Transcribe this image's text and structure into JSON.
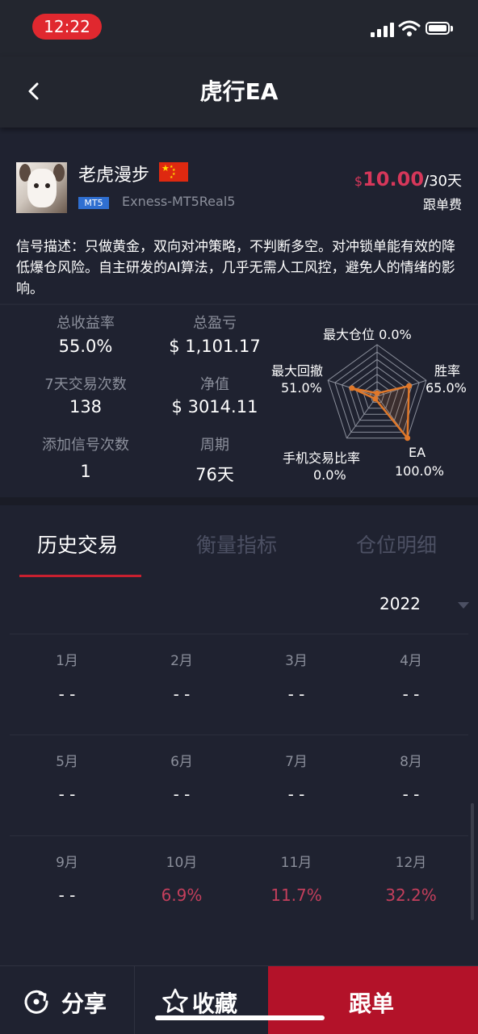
{
  "status_bar": {
    "time": "12:22"
  },
  "header": {
    "title": "虎行EA"
  },
  "profile": {
    "name": "老虎漫步",
    "platform_badge": "MT5",
    "server": "Exness-MT5Real5",
    "price_currency": "$",
    "price_amount": "10.00",
    "price_period": "/30天",
    "price_label": "跟单费",
    "description": "信号描述：只做黄金，双向对冲策略，不判断多空。对冲锁单能有效的降低爆仓风险。自主研发的AI算法，几乎无需人工风控，避免人的情绪的影响。"
  },
  "stats": [
    {
      "label": "总收益率",
      "value": "55.0%"
    },
    {
      "label": "总盈亏",
      "value": "$ 1,101.17"
    },
    {
      "label": "7天交易次数",
      "value": "138"
    },
    {
      "label": "净值",
      "value": "$ 3014.11"
    },
    {
      "label": "添加信号次数",
      "value": "1"
    },
    {
      "label": "周期",
      "value": "76天"
    }
  ],
  "radar": {
    "axes": [
      {
        "label": "最大仓位",
        "value": "0.0%",
        "fraction": 0.0
      },
      {
        "label": "胜率",
        "value": "65.0%",
        "fraction": 0.65
      },
      {
        "label": "EA",
        "value": "100.0%",
        "fraction": 1.0
      },
      {
        "label": "手机交易比率",
        "value": "0.0%",
        "fraction": 0.0
      },
      {
        "label": "最大回撤",
        "value": "51.0%",
        "fraction": 0.51
      }
    ],
    "grid_color": "#8b8f9b",
    "fill_color": "#e0782a"
  },
  "tabs": [
    {
      "label": "历史交易",
      "active": true
    },
    {
      "label": "衡量指标",
      "active": false
    },
    {
      "label": "仓位明细",
      "active": false
    }
  ],
  "year": "2022",
  "months": [
    {
      "label": "1月",
      "value": "- -"
    },
    {
      "label": "2月",
      "value": "- -"
    },
    {
      "label": "3月",
      "value": "- -"
    },
    {
      "label": "4月",
      "value": "- -"
    },
    {
      "label": "5月",
      "value": "- -"
    },
    {
      "label": "6月",
      "value": "- -"
    },
    {
      "label": "7月",
      "value": "- -"
    },
    {
      "label": "8月",
      "value": "- -"
    },
    {
      "label": "9月",
      "value": "- -"
    },
    {
      "label": "10月",
      "value": "6.9%"
    },
    {
      "label": "11月",
      "value": "11.7%"
    },
    {
      "label": "12月",
      "value": "32.2%"
    }
  ],
  "bottom_bar": {
    "share_label": "分享",
    "favorite_label": "收藏",
    "follow_label": "跟单"
  },
  "colors": {
    "background": "#1f2230",
    "accent_red": "#b31229",
    "positive": "#c43f5c",
    "price": "#d6375a"
  }
}
